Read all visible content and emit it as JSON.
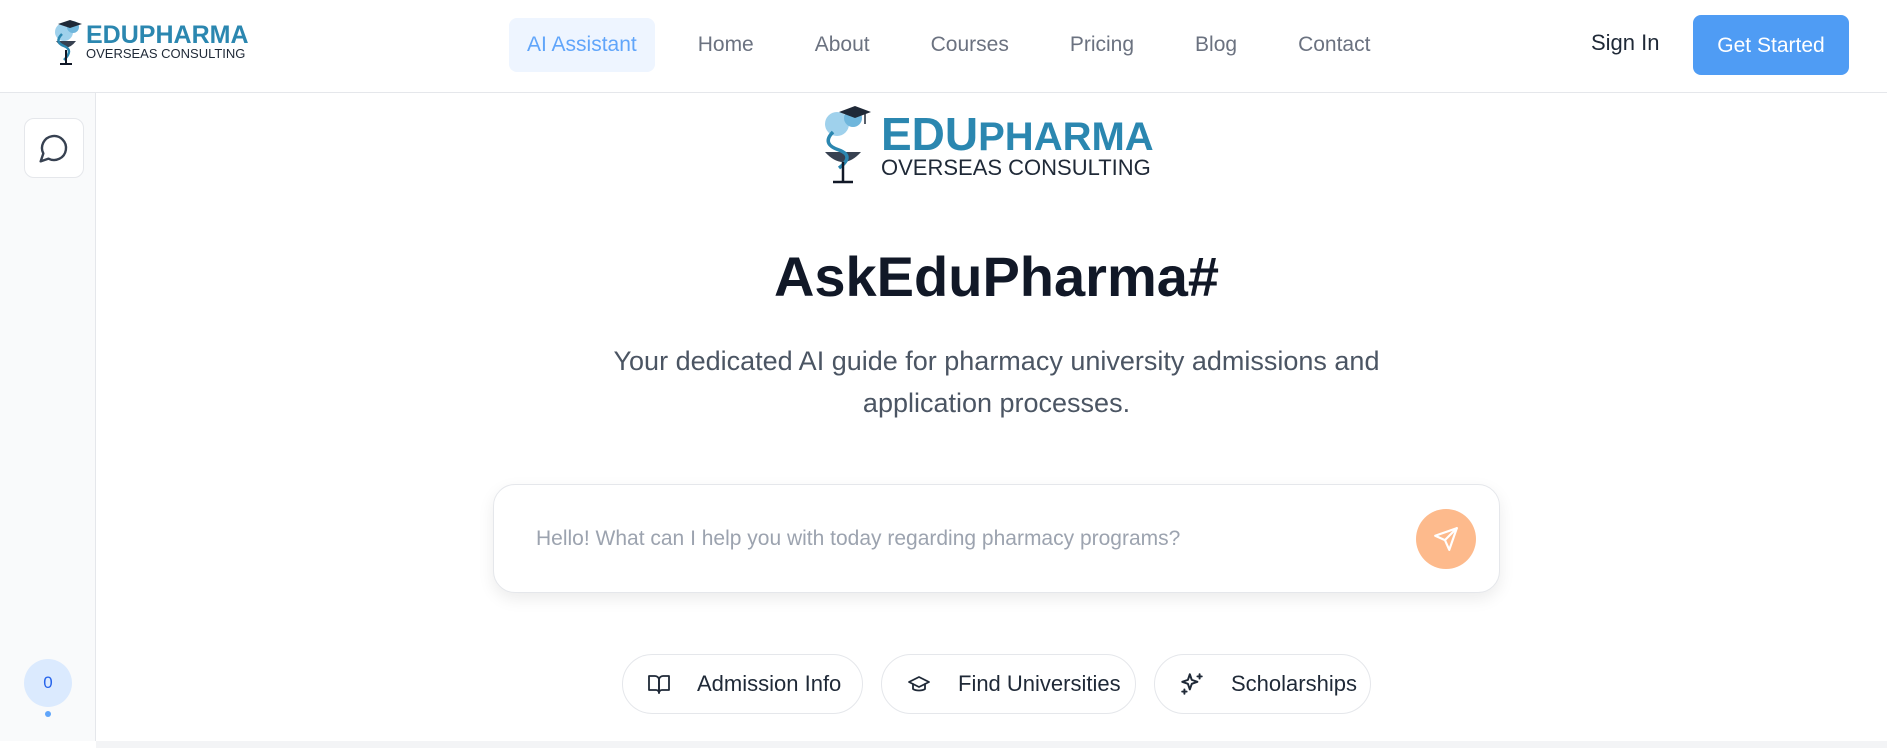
{
  "brand": {
    "name_part1": "EDU",
    "name_part2": "PHARMA",
    "tagline": "OVERSEAS CONSULTING"
  },
  "nav": {
    "items": [
      {
        "label": "AI Assistant",
        "active": true
      },
      {
        "label": "Home"
      },
      {
        "label": "About"
      },
      {
        "label": "Courses"
      },
      {
        "label": "Pricing"
      },
      {
        "label": "Blog"
      },
      {
        "label": "Contact"
      }
    ]
  },
  "header": {
    "sign_in": "Sign In",
    "get_started": "Get Started"
  },
  "sidebar": {
    "chat_icon": "chat-bubble-icon",
    "count": "0"
  },
  "main": {
    "title": "AskEduPharma#",
    "subtitle": "Your dedicated AI guide for pharmacy university admissions and application processes.",
    "input_placeholder": "Hello! What can I help you with today regarding pharmacy programs?",
    "send_icon": "send-icon",
    "chips": [
      {
        "label": "Admission Info",
        "icon": "book-open-icon"
      },
      {
        "label": "Find Universities",
        "icon": "graduation-cap-icon"
      },
      {
        "label": "Scholarships",
        "icon": "sparkles-icon"
      }
    ]
  },
  "colors": {
    "accent_blue": "#4f9cf4",
    "active_nav_bg": "#eef5ff",
    "active_nav_text": "#60a5fa",
    "send_button": "#fdba8c",
    "logo_teal": "#2b87b0"
  }
}
